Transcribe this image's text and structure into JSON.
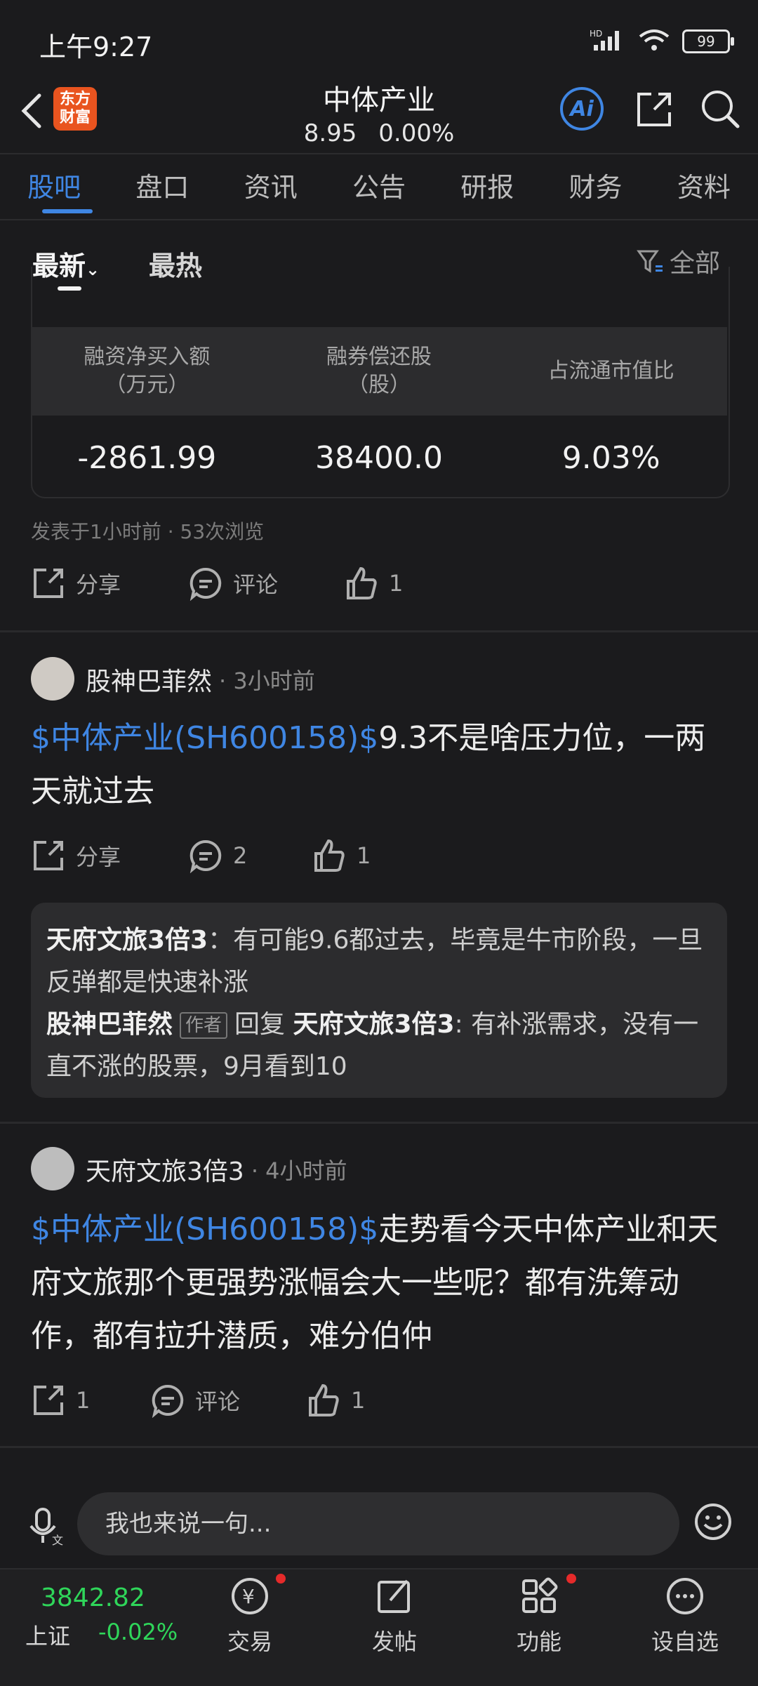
{
  "status_bar": {
    "time": "上午9:27",
    "battery": "99",
    "network": "HD"
  },
  "header": {
    "logo_text": "东方财富",
    "title": "中体产业",
    "price": "8.95",
    "change": "0.00%",
    "ai_label": "Ai"
  },
  "tabs": [
    "股吧",
    "盘口",
    "资讯",
    "公告",
    "研报",
    "财务",
    "资料"
  ],
  "active_tab": "股吧",
  "sort": {
    "newest": "最新",
    "hottest": "最热",
    "filter": "全部"
  },
  "margin_table": {
    "headers": [
      "融资净买入额\n（万元）",
      "融券偿还股\n（股）",
      "占流通市值比"
    ],
    "values": [
      "-2861.99",
      "38400.0",
      "9.03%"
    ]
  },
  "post0": {
    "meta": "发表于1小时前 · 53次浏览",
    "share": "分享",
    "comment": "评论",
    "likes": "1"
  },
  "post1": {
    "user": "股神巴菲然",
    "time": "· 3小时前",
    "tag": "$中体产业(SH600158)$",
    "text": "9.3不是啥压力位，一两天就过去",
    "share": "分享",
    "comments": "2",
    "likes": "1",
    "reply1_user": "天府文旅3倍3",
    "reply1_text": "：有可能9.6都过去，毕竟是牛市阶段，一旦反弹都是快速补涨",
    "reply2_user": "股神巴菲然",
    "reply2_badge": "作者",
    "reply2_verb": "回复",
    "reply2_target": "天府文旅3倍3",
    "reply2_text": ": 有补涨需求，没有一直不涨的股票，9月看到10"
  },
  "post2": {
    "user": "天府文旅3倍3",
    "time": "· 4小时前",
    "tag": "$中体产业(SH600158)$",
    "text": "走势看今天中体产业和天府文旅那个更强势涨幅会大一些呢？都有洗筹动作，都有拉升潜质，难分伯仲",
    "shares": "1",
    "comment": "评论",
    "likes": "1"
  },
  "input": {
    "placeholder": "我也来说一句..."
  },
  "bottom_nav": {
    "index_value": "3842.82",
    "index_name": "上证",
    "index_change": "-0.02%",
    "trade": "交易",
    "post": "发帖",
    "features": "功能",
    "watchlist": "设自选"
  },
  "colors": {
    "accent": "#3f86e3",
    "up_green": "#2fd65a",
    "logo": "#e9541f",
    "badge_red": "#e52a2a"
  }
}
